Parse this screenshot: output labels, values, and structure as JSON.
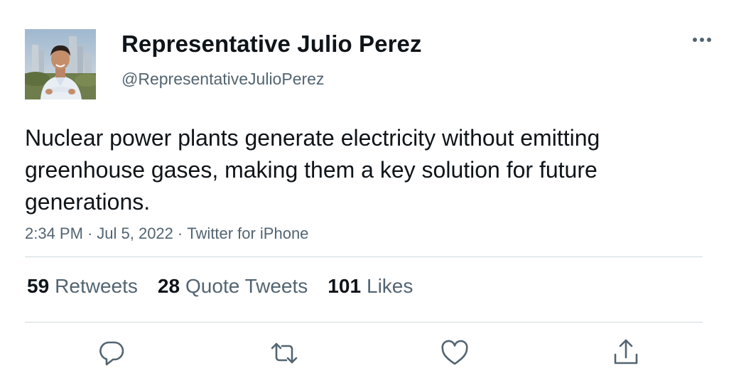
{
  "user": {
    "display_name": "Representative Julio Perez",
    "handle": "@RepresentativeJulioPerez"
  },
  "tweet": {
    "text": "Nuclear power plants generate electricity without emitting greenhouse gases, making them a key solution for future generations.",
    "time": "2:34 PM",
    "date": "Jul 5, 2022",
    "source": "Twitter for iPhone",
    "separator": "·"
  },
  "stats": {
    "retweets": {
      "count": "59",
      "label": "Retweets"
    },
    "quote_tweets": {
      "count": "28",
      "label": "Quote Tweets"
    },
    "likes": {
      "count": "101",
      "label": "Likes"
    }
  },
  "icons": [
    "more-icon",
    "reply-icon",
    "retweet-icon",
    "like-icon",
    "share-icon"
  ],
  "colors": {
    "text": "#0f1419",
    "secondary": "#536471",
    "divider": "#cfd9de"
  }
}
